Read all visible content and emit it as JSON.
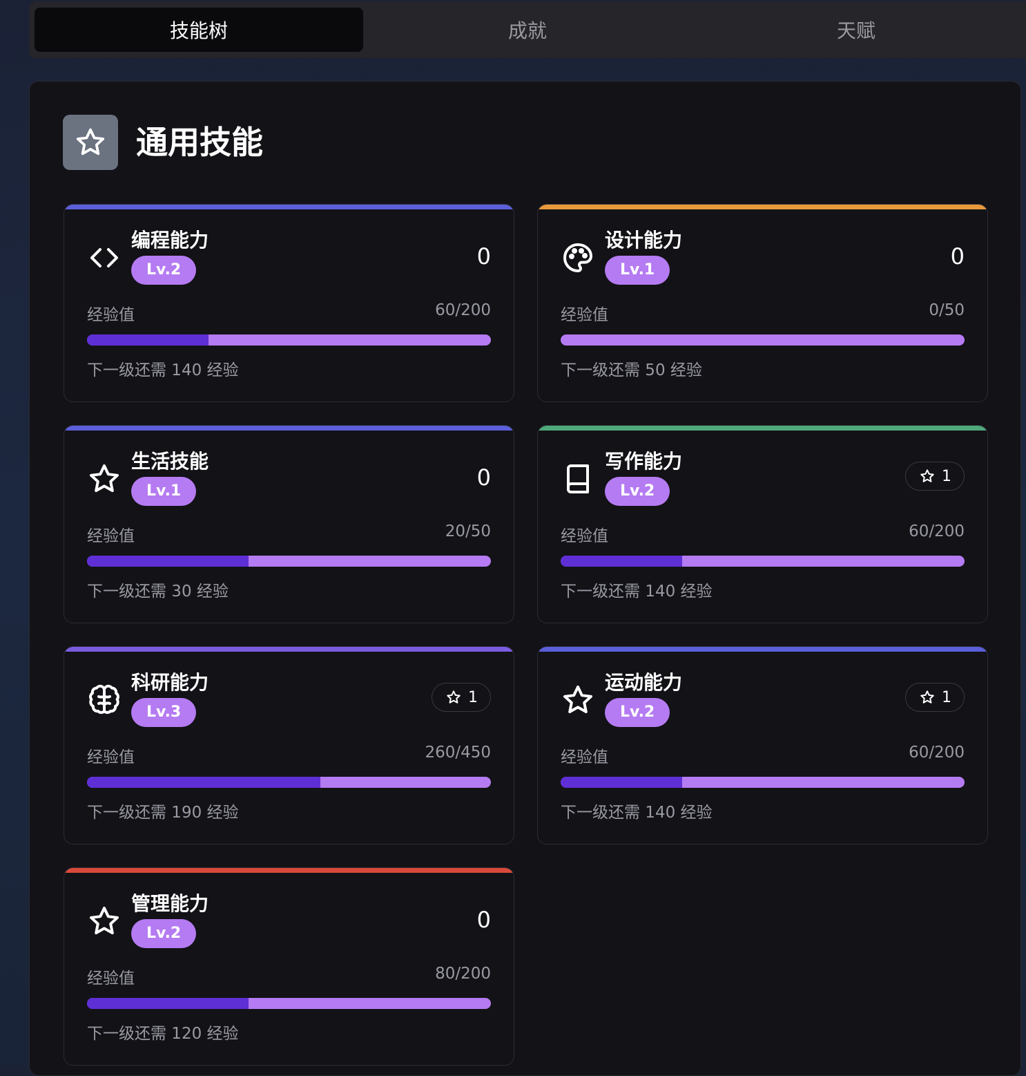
{
  "tabs": [
    {
      "label": "技能树",
      "active": true
    },
    {
      "label": "成就",
      "active": false
    },
    {
      "label": "天赋",
      "active": false
    }
  ],
  "category": {
    "title": "通用技能",
    "icon": "star-icon"
  },
  "exp_label": "经验值",
  "skills": [
    {
      "name": "编程能力",
      "level": "Lv.2",
      "points": "0",
      "points_badge": false,
      "exp": "60/200",
      "progress": 0.3,
      "next": "下一级还需 140 经验",
      "icon": "code-icon",
      "accent": "#5b5fd9"
    },
    {
      "name": "设计能力",
      "level": "Lv.1",
      "points": "0",
      "points_badge": false,
      "exp": "0/50",
      "progress": 0.0,
      "next": "下一级还需 50 经验",
      "icon": "palette-icon",
      "accent": "#e69a3a"
    },
    {
      "name": "生活技能",
      "level": "Lv.1",
      "points": "0",
      "points_badge": false,
      "exp": "20/50",
      "progress": 0.4,
      "next": "下一级还需 30 经验",
      "icon": "star-icon",
      "accent": "#5b5fd9"
    },
    {
      "name": "写作能力",
      "level": "Lv.2",
      "points": "1",
      "points_badge": true,
      "exp": "60/200",
      "progress": 0.3,
      "next": "下一级还需 140 经验",
      "icon": "book-icon",
      "accent": "#4fa87a"
    },
    {
      "name": "科研能力",
      "level": "Lv.3",
      "points": "1",
      "points_badge": true,
      "exp": "260/450",
      "progress": 0.578,
      "next": "下一级还需 190 经验",
      "icon": "brain-icon",
      "accent": "#7b5be0"
    },
    {
      "name": "运动能力",
      "level": "Lv.2",
      "points": "1",
      "points_badge": true,
      "exp": "60/200",
      "progress": 0.3,
      "next": "下一级还需 140 经验",
      "icon": "star-icon",
      "accent": "#5b5fd9"
    },
    {
      "name": "管理能力",
      "level": "Lv.2",
      "points": "0",
      "points_badge": false,
      "exp": "80/200",
      "progress": 0.4,
      "next": "下一级还需 120 经验",
      "icon": "star-icon",
      "accent": "#d9493a"
    }
  ]
}
